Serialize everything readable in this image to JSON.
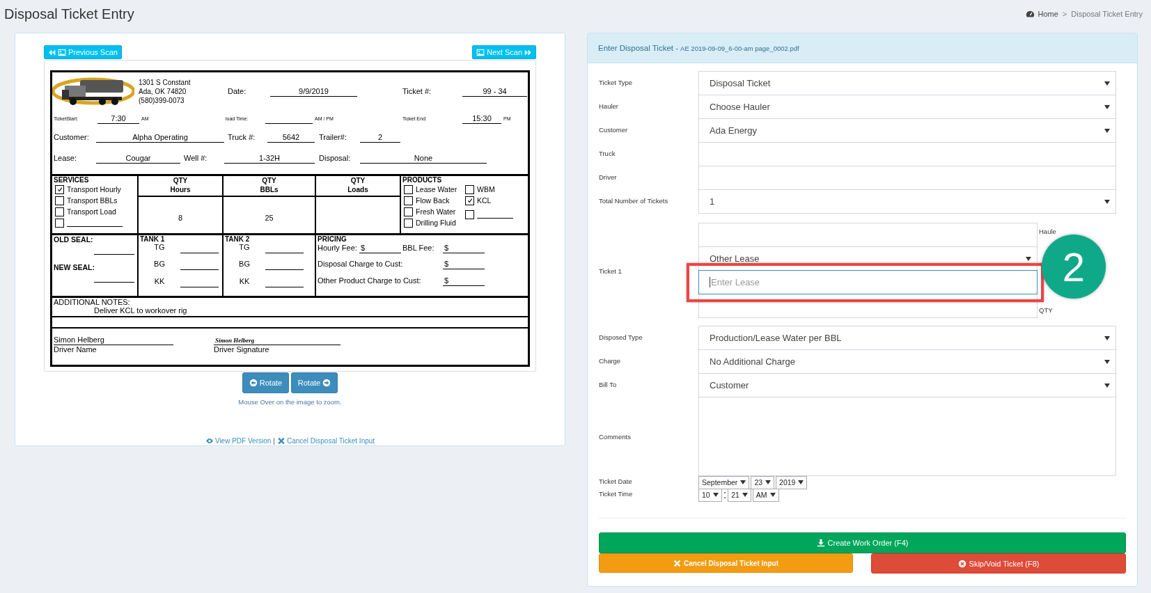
{
  "page": {
    "title": "Disposal Ticket Entry"
  },
  "breadcrumb": [
    {
      "kind": "home",
      "text": "Home"
    },
    {
      "kind": "sep",
      "text": ">"
    },
    {
      "kind": "current",
      "text": "Disposal Ticket Entry"
    }
  ],
  "scan": {
    "prev_button": "Previous Scan",
    "next_button": "Next Scan",
    "ticket": {
      "address": [
        "1301 S Constant",
        "Ada, OK 74820",
        "(580)399-0073"
      ],
      "header_rows": [
        [
          {
            "label": "Date:",
            "value": "9/9/2019"
          },
          {
            "label": "Ticket #:",
            "value": "99 - 34"
          }
        ],
        [
          {
            "label": "TicketStart:",
            "value": "7:30",
            "suffix": "AM"
          },
          {
            "label": "load Time:",
            "suffix": "AM / PM"
          },
          {
            "label": "Ticket End:",
            "value": "15:30",
            "suffix": "PM"
          }
        ],
        [
          {
            "label": "Customer:",
            "value": "Alpha Operating"
          },
          {
            "label": "Truck #:",
            "value": "5642"
          },
          {
            "label": "Trailer#:",
            "value": "2"
          }
        ],
        [
          {
            "label": "Lease:",
            "value": "Cougar"
          },
          {
            "label": "Well #:",
            "value": "1-32H"
          },
          {
            "label": "Disposal:",
            "value": "None"
          }
        ]
      ],
      "services": {
        "title": "SERVICES",
        "items": [
          {
            "label": "Transport Hourly",
            "checked": true
          },
          {
            "label": "Transport BBLs",
            "checked": false
          },
          {
            "label": "Transport Load",
            "checked": false
          },
          {
            "kind": "blank",
            "checked": false
          }
        ]
      },
      "quantities": [
        {
          "title": "QTY",
          "unit": "Hours",
          "value": "8"
        },
        {
          "title": "QTY",
          "unit": "BBLs",
          "value": "25"
        },
        {
          "title": "QTY",
          "unit": "Loads"
        }
      ],
      "products": {
        "title": "PRODUCTS",
        "columns": [
          [
            {
              "label": "Lease Water",
              "checked": false
            },
            {
              "label": "Flow Back",
              "checked": false
            },
            {
              "label": "Fresh Water",
              "checked": false
            },
            {
              "label": "Drilling Fluid",
              "checked": false
            }
          ],
          [
            {
              "label": "WBM",
              "checked": false
            },
            {
              "label": "KCL",
              "checked": true
            },
            {
              "kind": "blank",
              "checked": false
            }
          ]
        ]
      },
      "seals": [
        {
          "label": "OLD SEAL:"
        },
        {
          "label": "NEW SEAL:"
        }
      ],
      "tanks": [
        {
          "title": "TANK 1",
          "readings": [
            "TG",
            "BG",
            "KK"
          ]
        },
        {
          "title": "TANK 2",
          "readings": [
            "TG",
            "BG",
            "KK"
          ]
        }
      ],
      "pricing": {
        "title": "PRICING",
        "rows": [
          [
            {
              "label": "Hourly Fee:",
              "currency": "$"
            },
            {
              "label": "BBL Fee:",
              "currency": "$"
            }
          ],
          [
            {
              "label": "Disposal Charge to Cust:",
              "currency": "$"
            }
          ],
          [
            {
              "label": "Other Product Charge to Cust:",
              "currency": "$"
            }
          ]
        ]
      },
      "notes": {
        "title": "ADDITIONAL NOTES:",
        "text": "Deliver KCL to workover rig"
      },
      "driver": {
        "name": "Simon Helberg",
        "name_caption": "Driver Name",
        "signature": "Simon Helberg",
        "signature_caption": "Driver Signature"
      }
    },
    "rotate_buttons": [
      {
        "kind": "left",
        "label": "Rotate"
      },
      {
        "kind": "right",
        "label": "Rotate"
      }
    ],
    "hint": "Mouse Over on the image to zoom.",
    "links": [
      {
        "kind": "view",
        "text": "View PDF Version"
      },
      {
        "kind": "sep",
        "text": "|"
      },
      {
        "kind": "cancel",
        "text": "Cancel Disposal Ticket Input"
      }
    ]
  },
  "form": {
    "title": "Enter Disposal Ticket - ",
    "file": "AE 2019-09-09_6-00-am page_0002.pdf",
    "fields": [
      {
        "label": "Ticket Type",
        "kind": "select",
        "value": "Disposal Ticket"
      },
      {
        "label": "Hauler",
        "kind": "select",
        "value": "Choose Hauler"
      },
      {
        "label": "Customer",
        "kind": "select",
        "value": "Ada Energy"
      },
      {
        "label": "Truck",
        "kind": "input"
      },
      {
        "label": "Driver",
        "kind": "input"
      },
      {
        "label": "Total Number of Tickets",
        "kind": "select",
        "value": "1"
      },
      {
        "label": "Ticket 1",
        "kind": "group",
        "controls": [
          {
            "kind": "input",
            "side_label": "Haule"
          },
          {
            "kind": "select",
            "value": "Other Lease"
          },
          {
            "kind": "input",
            "placeholder": "Enter Lease",
            "focused": true
          },
          {
            "kind": "input",
            "side_label": "QTY"
          }
        ]
      },
      {
        "label": "Disposed Type",
        "kind": "select",
        "value": "Production/Lease Water per BBL"
      },
      {
        "label": "Charge",
        "kind": "select",
        "value": "No Additional Charge"
      },
      {
        "label": "Bill To",
        "kind": "select",
        "value": "Customer"
      },
      {
        "label": "Comments",
        "kind": "textarea"
      },
      {
        "label": "Ticket Date",
        "kind": "inline",
        "parts": [
          {
            "kind": "select",
            "value": "September"
          },
          {
            "kind": "select",
            "value": "23"
          },
          {
            "kind": "select",
            "value": "2019"
          }
        ]
      },
      {
        "label": "Ticket Time",
        "kind": "inline",
        "parts": [
          {
            "kind": "select",
            "value": "10"
          },
          {
            "kind": "sep",
            "text": ":"
          },
          {
            "kind": "select",
            "value": "21"
          },
          {
            "kind": "select",
            "value": "AM"
          }
        ]
      }
    ],
    "buttons": [
      {
        "kind": "create",
        "label": "Create Work Order (F4)"
      },
      {
        "kind": "cancel",
        "label": "Cancel Disposal Ticket Input"
      },
      {
        "kind": "skip",
        "label": "Skip/Void Ticket (F8)"
      }
    ]
  },
  "annotation": {
    "number": "2",
    "highlight": true
  }
}
